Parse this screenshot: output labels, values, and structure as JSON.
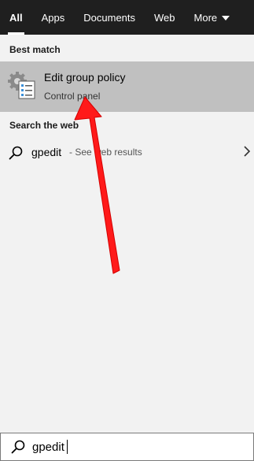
{
  "tabs": [
    {
      "label": "All",
      "active": true
    },
    {
      "label": "Apps"
    },
    {
      "label": "Documents"
    },
    {
      "label": "Web"
    },
    {
      "label": "More"
    }
  ],
  "best_match": {
    "heading": "Best match",
    "title": "Edit group policy",
    "subtitle": "Control panel",
    "icon": "control-panel-gear-checklist-icon"
  },
  "web": {
    "heading": "Search the web",
    "query": "gpedit",
    "suffix": "- See web results",
    "icon": "search-icon"
  },
  "searchbar": {
    "value": "gpedit",
    "icon": "search-icon"
  },
  "annotation": {
    "arrow_color": "#ff1a1a"
  }
}
